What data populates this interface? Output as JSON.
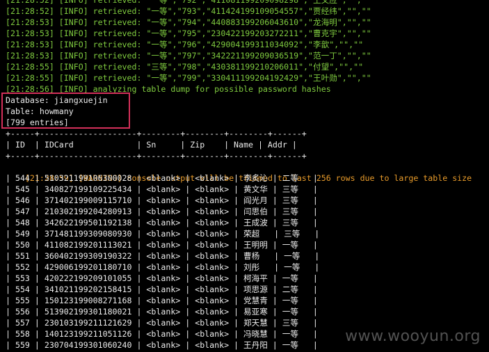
{
  "log_lines": [
    {
      "time": "[21:28:52]",
      "level": "[INFO]",
      "text": " retrieved: \"一等\",\"792\",\"411081199209098298\",\"王文应\",\"\",\"\""
    },
    {
      "time": "[21:28:52]",
      "level": "[INFO]",
      "text": " retrieved: \"一等\",\"793\",\"411424199109054557\",\"贾经纬\",\"\",\"\""
    },
    {
      "time": "[21:28:53]",
      "level": "[INFO]",
      "text": " retrieved: \"一等\",\"794\",\"440883199206043610\",\"龙海明\",\"\",\"\""
    },
    {
      "time": "[21:28:53]",
      "level": "[INFO]",
      "text": " retrieved: \"一等\",\"795\",\"230422199203272211\",\"曹克宇\",\"\",\"\""
    },
    {
      "time": "[21:28:53]",
      "level": "[INFO]",
      "text": " retrieved: \"一等\",\"796\",\"429004199311034092\",\"李歆\",\"\",\"\""
    },
    {
      "time": "[21:28:53]",
      "level": "[INFO]",
      "text": " retrieved: \"一等\",\"797\",\"342221199209036519\",\"范一丁\",\"\",\"\""
    },
    {
      "time": "[21:28:55]",
      "level": "[INFO]",
      "text": " retrieved: \"三等\",\"798\",\"430381199210206011\",\"付望\",\"\",\"\""
    },
    {
      "time": "[21:28:55]",
      "level": "[INFO]",
      "text": " retrieved: \"一等\",\"799\",\"330411199204192429\",\"王叶勋\",\"\",\"\""
    },
    {
      "time": "[21:28:56]",
      "level": "[INFO]",
      "text": " analyzing table dump for possible password hashes"
    }
  ],
  "dump_header": {
    "database": "Database: jiangxuejin",
    "table": "Table: howmany",
    "entries": "[799 entries]"
  },
  "table_border": "+-----+--------------------+--------+--------+--------+------+",
  "table_columns": "| ID  | IDCard             | Sn     | Zip    | Name | Addr |",
  "warning": {
    "time": "[21:28:59]",
    "level": "[WARNING]",
    "text": " console output will be trimmed to last 256 rows due to large table size"
  },
  "rows": [
    "| 544 | 510321199106300028 | <blank> | <blank> | 李炙沁 | 二等   |",
    "| 545 | 340827199109225434 | <blank> | <blank> | 黄文华 | 三等   |",
    "| 546 | 371402199009115710 | <blank> | <blank> | 阎光月 | 三等   |",
    "| 547 | 210302199204280913 | <blank> | <blank> | 闫思伯 | 三等   |",
    "| 548 | 342622199501192138 | <blank> | <blank> | 王成波 | 三等   |",
    "| 549 | 371481199309080930 | <blank> | <blank> | 荣超   | 三等   |",
    "| 550 | 411082199201113021 | <blank> | <blank> | 王明明 | 一等   |",
    "| 551 | 360402199309190322 | <blank> | <blank> | 曹杨   | 一等   |",
    "| 552 | 429006199201180710 | <blank> | <blank> | 刘彤   | 一等   |",
    "| 553 | 420222199209101055 | <blank> | <blank> | 柯海平 | 一等   |",
    "| 554 | 341021199202158415 | <blank> | <blank> | 项思源 | 二等   |",
    "| 555 | 150123199008271168 | <blank> | <blank> | 党慧青 | 一等   |",
    "| 556 | 513902199301180021 | <blank> | <blank> | 易亚寒 | 一等   |",
    "| 557 | 230103199211121629 | <blank> | <blank> | 郑天慧 | 三等   |",
    "| 558 | 140123199211051126 | <blank> | <blank> | 冯晓慧 | 一等   |",
    "| 559 | 230704199301060240 | <blank> | <blank> | 王丹阳 | 一等   |"
  ],
  "watermark": "www.wooyun.org",
  "colors": {
    "info": "#7fcb3f",
    "warning": "#e89b2a",
    "highlight": "#d4305a",
    "background": "#000000"
  }
}
